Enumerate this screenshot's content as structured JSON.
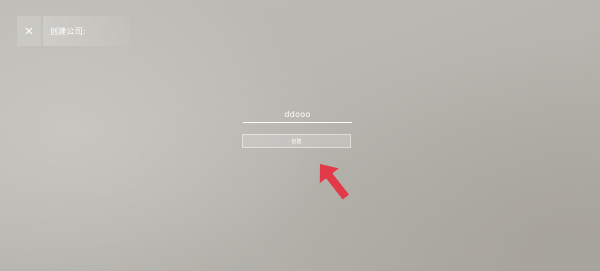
{
  "dialog": {
    "title": "创建公司:",
    "close_icon": "close-icon",
    "name_field": {
      "value": "ddooo"
    },
    "create_button": {
      "label": "创建"
    }
  },
  "annotation": {
    "arrow_icon": "arrow-pointer-icon",
    "arrow_color": "#e23a48"
  }
}
